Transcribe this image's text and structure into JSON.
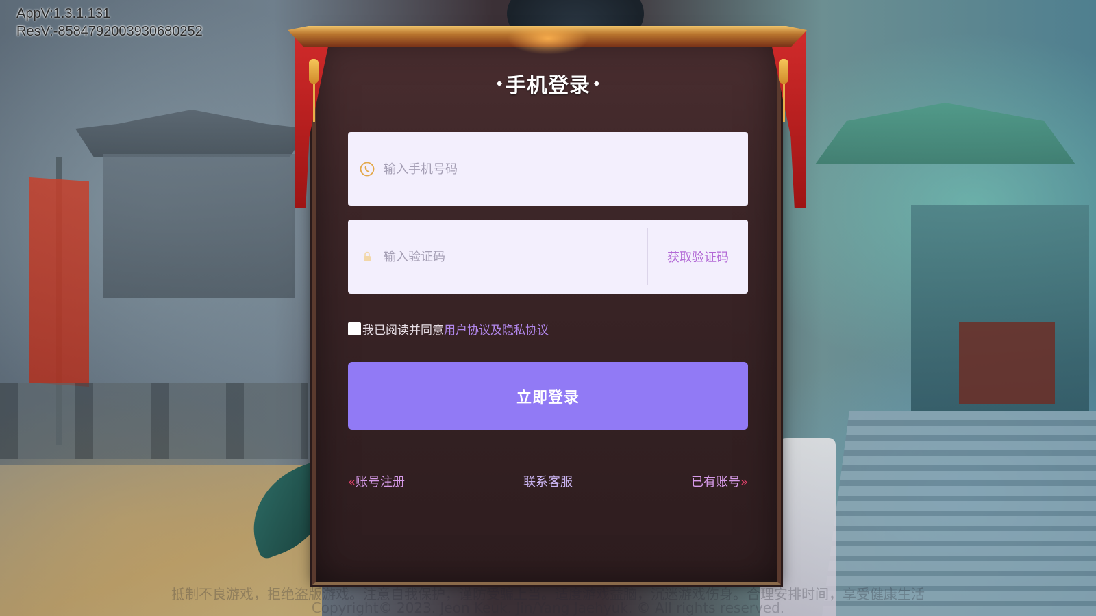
{
  "version": {
    "app": "AppV:1.3.1.131",
    "res": "ResV:-8584792003930680252"
  },
  "login": {
    "title": "手机登录",
    "phone_placeholder": "输入手机号码",
    "code_placeholder": "输入验证码",
    "get_code_label": "获取验证码",
    "agree_text": "我已阅读并同意",
    "agree_link": "用户协议及隐私协议",
    "submit_label": "立即登录",
    "register_label": "账号注册",
    "service_label": "联系客服",
    "has_account_label": "已有账号",
    "arrow_left": "«",
    "arrow_right": "»",
    "agreed": false
  },
  "footer": {
    "line1": "抵制不良游戏，拒绝盗版游戏。注意自我保护，谨防受骗上当。适度游戏益脑，沉迷游戏伤身。合理安排时间，享受健康生活",
    "line2": "Copyright© 2023. Jeon Keuk. Jin/Yang Jaehyuk. © All rights reserved."
  },
  "icons": {
    "phone": "phone-icon",
    "lock": "lock-icon"
  },
  "colors": {
    "accent": "#917af5",
    "link": "#b287ec",
    "get_code": "#b36ad6",
    "field_bg": "#f3effd"
  }
}
